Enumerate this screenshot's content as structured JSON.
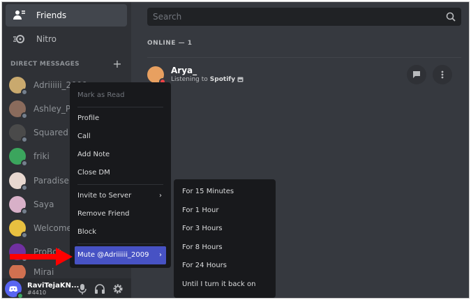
{
  "sidebar": {
    "nav": [
      {
        "label": "Friends",
        "icon": "friends-icon"
      },
      {
        "label": "Nitro",
        "icon": "nitro-icon"
      }
    ],
    "dm_header": "DIRECT MESSAGES",
    "dms": [
      {
        "name": "Adriiiiii_2009",
        "color": "#c9a96e"
      },
      {
        "name": "Ashley_Pa",
        "color": "#8a6b5c"
      },
      {
        "name": "Squared G",
        "color": "#4a4a4a"
      },
      {
        "name": "friki",
        "color": "#3ba55d"
      },
      {
        "name": "Paradise",
        "color": "#e8d8d0"
      },
      {
        "name": "Saya",
        "color": "#d8b0c8"
      },
      {
        "name": "Welcomer",
        "color": "#e8c040"
      },
      {
        "name": "ProBot",
        "color": "#7030a0"
      },
      {
        "name": "Mirai",
        "color": "#d07050"
      }
    ],
    "user": {
      "name": "RaviTejaKN...",
      "tag": "#4410"
    }
  },
  "main": {
    "search_placeholder": "Search",
    "online_label": "ONLINE — 1",
    "friend": {
      "name": "Arya_",
      "activity_prefix": "Listening to",
      "activity_app": "Spotify"
    }
  },
  "context_menu": {
    "items": [
      {
        "label": "Mark as Read",
        "disabled": true
      },
      {
        "sep": true
      },
      {
        "label": "Profile"
      },
      {
        "label": "Call"
      },
      {
        "label": "Add Note"
      },
      {
        "label": "Close DM"
      },
      {
        "sep": true
      },
      {
        "label": "Invite to Server",
        "submenu": true
      },
      {
        "label": "Remove Friend"
      },
      {
        "label": "Block"
      },
      {
        "sep": true
      },
      {
        "label": "Mute @Adriiiiii_2009",
        "submenu": true,
        "highlight": true
      }
    ]
  },
  "mute_submenu": [
    "For 15 Minutes",
    "For 1 Hour",
    "For 3 Hours",
    "For 8 Hours",
    "For 24 Hours",
    "Until I turn it back on"
  ],
  "colors": {
    "accent": "#4752c4",
    "arrow": "#ff0000",
    "online": "#3ba55d",
    "dnd": "#ed4245"
  }
}
